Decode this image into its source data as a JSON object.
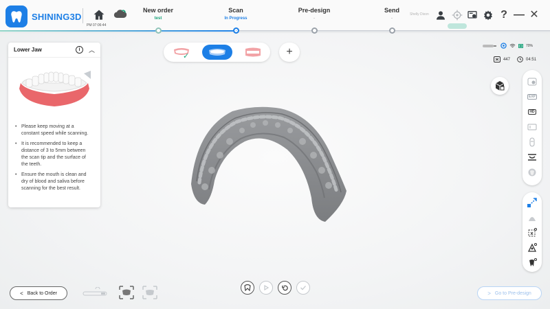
{
  "brand": {
    "name": "SHINING3D",
    "color": "#1d7fe6"
  },
  "header": {
    "home_time": "PM 07:06:44",
    "user_name": "Shelly Dixon",
    "version_badge": "",
    "steps": [
      {
        "title": "New order",
        "sub": "test",
        "state": "done"
      },
      {
        "title": "Scan",
        "sub": "In Progress",
        "state": "current"
      },
      {
        "title": "Pre-design",
        "sub": "-",
        "state": "pending"
      },
      {
        "title": "Send",
        "sub": "-",
        "state": "pending"
      }
    ],
    "icons": [
      "user-icon",
      "target-icon",
      "screen-settings-icon",
      "gear-icon",
      "help-icon",
      "minimize-icon",
      "close-icon"
    ],
    "help_glyph": "?",
    "minimize_glyph": "—",
    "close_glyph": "✕"
  },
  "info_panel": {
    "title": "Lower Jaw",
    "tips": [
      "Please keep moving at a constant speed while scanning.",
      "It is recommended to keep a distance of 3 to 5mm between the scan tip and the surface of the teeth.",
      "Ensure the mouth is clean and dry of blood and saliva before scanning for the best result."
    ]
  },
  "jaw_selector": {
    "tabs": [
      {
        "name": "upper-jaw",
        "state": "completed"
      },
      {
        "name": "lower-jaw",
        "state": "active"
      },
      {
        "name": "bite",
        "state": "idle"
      }
    ],
    "add_label": "+"
  },
  "status": {
    "battery": "70%",
    "frame_count": "447",
    "timer": "04:51"
  },
  "bottom": {
    "back_label": "Back to Order",
    "next_label": "Go to Pre-design"
  }
}
